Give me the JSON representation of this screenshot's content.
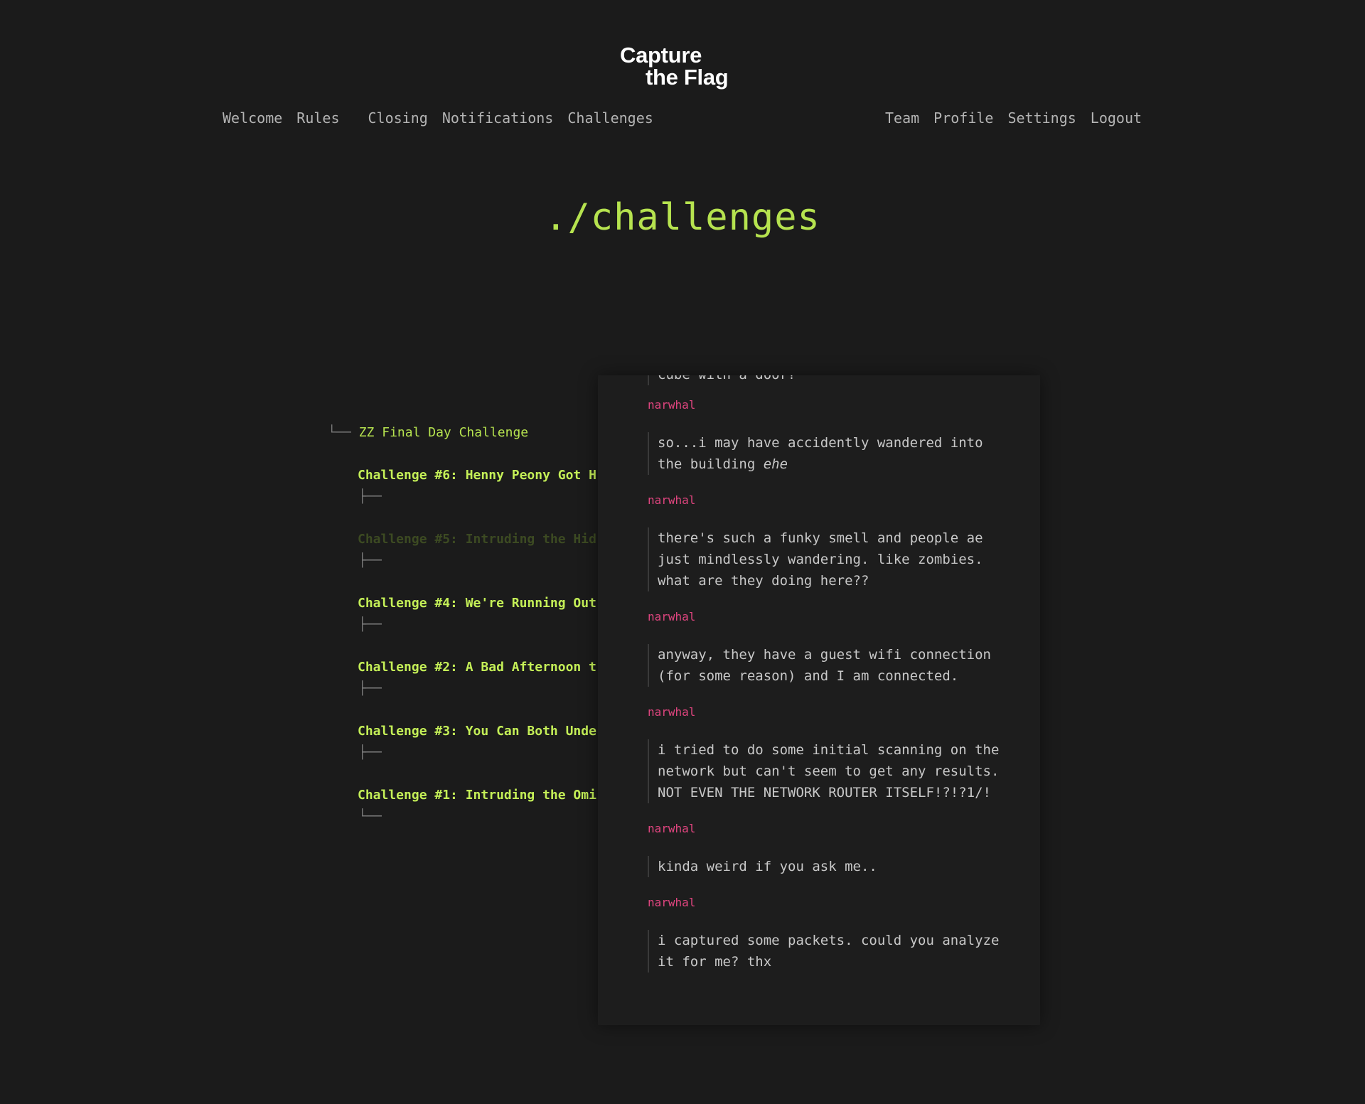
{
  "logo": {
    "line1": "Capture",
    "line2": "the Flag"
  },
  "nav_left": [
    "Welcome",
    "Rules",
    "Closing",
    "Notifications",
    "Challenges"
  ],
  "nav_right": [
    "Team",
    "Profile",
    "Settings",
    "Logout"
  ],
  "page_title": "./challenges",
  "tree": {
    "root": {
      "branch": "└──",
      "label": "ZZ Final Day Challenge"
    },
    "items": [
      {
        "branch": "├──",
        "label": "Challenge #6: Henny Peony Got H"
      },
      {
        "branch": "├──",
        "label": "Challenge #5: Intruding the Hid"
      },
      {
        "branch": "├──",
        "label": "Challenge #4: We're Running Out"
      },
      {
        "branch": "├──",
        "label": "Challenge #2: A Bad Afternoon t"
      },
      {
        "branch": "├──",
        "label": "Challenge #3: You Can Both Unde"
      },
      {
        "branch": "└──",
        "label": "Challenge #1: Intruding the Omi"
      }
    ]
  },
  "panel": {
    "top_fragment": "cube with a door?",
    "messages": [
      {
        "author": "narwhal",
        "text": "so...i may have accidently wandered into the building ",
        "emph": "ehe"
      },
      {
        "author": "narwhal",
        "text": "there's such a funky smell and people ae just mindlessly wandering. like zombies. what are they doing here??"
      },
      {
        "author": "narwhal",
        "text": "anyway, they have a guest wifi connection (for some reason) and I am connected."
      },
      {
        "author": "narwhal",
        "text": "i tried to do some initial scanning on the network but can't seem to get any results. NOT EVEN THE NETWORK ROUTER ITSELF!?!?1/!"
      },
      {
        "author": "narwhal",
        "text": "kinda weird if you ask me.."
      },
      {
        "author": "narwhal",
        "text": "i captured some packets. could you analyze it for me? thx"
      }
    ]
  },
  "colors": {
    "background": "#1b1b1b",
    "accent_green": "#b6e34f",
    "author_pink": "#e0457f"
  }
}
